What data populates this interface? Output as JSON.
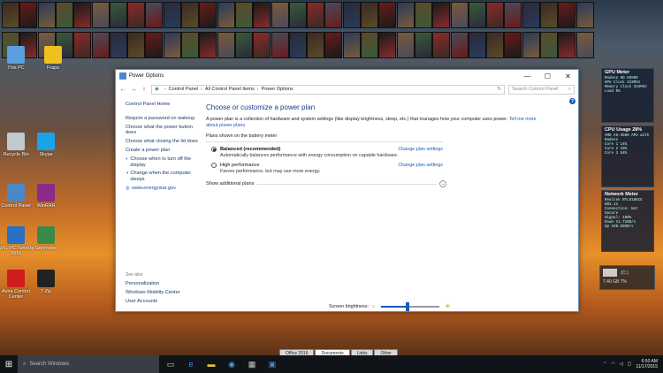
{
  "window": {
    "title": "Power Options",
    "controls": [
      "—",
      "☐",
      "✕"
    ],
    "breadcrumb": [
      "Control Panel",
      "All Control Panel Items",
      "Power Options"
    ],
    "search_placeholder": "Search Control Panel"
  },
  "left_pane": {
    "home": "Control Panel Home",
    "links": [
      "Require a password on wakeup",
      "Choose what the power button does",
      "Choose what closing the lid does",
      "Create a power plan",
      "Choose when to turn off the display",
      "Change when the computer sleeps"
    ],
    "external_link": "www.energystar.gov",
    "see_also_heading": "See also",
    "see_also": [
      "Personalization",
      "Windows Mobility Center",
      "User Accounts"
    ]
  },
  "main": {
    "heading": "Choose or customize a power plan",
    "description": "A power plan is a collection of hardware and system settings (like display brightness, sleep, etc.) that manages how your computer uses power.",
    "description_link": "Tell me more about power plans",
    "group_label": "Plans shown on the battery meter",
    "plans": [
      {
        "name": "Balanced (recommended)",
        "desc": "Automatically balances performance with energy consumption on capable hardware.",
        "change": "Change plan settings",
        "selected": true
      },
      {
        "name": "High performance",
        "desc": "Favors performance, but may use more energy.",
        "change": "Change plan settings",
        "selected": false
      }
    ],
    "additional": "Show additional plans"
  },
  "brightness": {
    "label": "Screen brightness:",
    "level": 0.45
  },
  "desktop_icons": [
    {
      "label": "This PC",
      "color": "#5aa0e0"
    },
    {
      "label": "Fraps",
      "color": "#f0c020"
    },
    {
      "label": "Recycle Bin",
      "color": "#c0c8d0"
    },
    {
      "label": "Skype",
      "color": "#1aa3e8"
    },
    {
      "label": "Control Panel",
      "color": "#4a88c8"
    },
    {
      "label": "WinRAR",
      "color": "#8a2a8a"
    },
    {
      "label": "AVG PC TuneUp 2015",
      "color": "#2a70c0"
    },
    {
      "label": "Geometer",
      "color": "#3a8a4a"
    },
    {
      "label": "Avira Control Center",
      "color": "#d01c1c"
    },
    {
      "label": "7-Zip",
      "color": "#222222"
    }
  ],
  "gadgets": {
    "gpu": {
      "title": "GPU Meter",
      "lines": [
        "Radeon HD 6550D",
        "GPU Clock 333MHz",
        "Memory Clock 333MHz",
        "Load 0%"
      ]
    },
    "cpu": {
      "title": "CPU Usage",
      "value": "28%",
      "lines": [
        "AMD A6-3500 APU with Radeon",
        "Core 1 14%",
        "Core 2 16%",
        "Core 3 54%"
      ]
    },
    "network": {
      "title": "Network Meter",
      "lines": [
        "Realtek RTL8188CE 802.11",
        "Connection: Not Secure",
        "Signal: 100%",
        "Down 11.71KB/s",
        "Up 198.58KB/s"
      ]
    },
    "drive": {
      "label": "(C:)",
      "free": "7.40 GB",
      "pct": "7%"
    }
  },
  "app_tabs": [
    {
      "label": "Office 2016",
      "selected": false
    },
    {
      "label": "Documents",
      "selected": true
    },
    {
      "label": "Links",
      "selected": false
    },
    {
      "label": "Other",
      "selected": false
    }
  ],
  "taskbar": {
    "search_placeholder": "Search Windows",
    "time": "6:50 AM",
    "date": "11/17/2015"
  },
  "colors": {
    "accent": "#1a5ab8",
    "heading": "#1a3f86"
  }
}
